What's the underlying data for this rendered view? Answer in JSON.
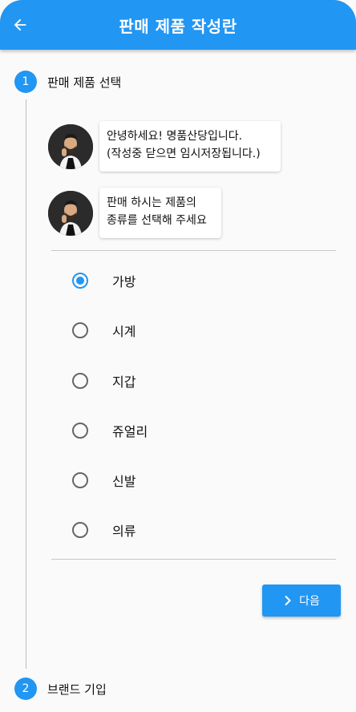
{
  "header": {
    "title": "판매 제품 작성란",
    "back_icon": "arrow-left-icon"
  },
  "steps": [
    {
      "number": "1",
      "label": "판매 제품 선택"
    },
    {
      "number": "2",
      "label": "브랜드 기입"
    }
  ],
  "chat": [
    {
      "line1": "안녕하세요! 명품산당입니다.",
      "line2": "(작성중 닫으면 임시저장됩니다.)"
    },
    {
      "line1": "판매 하시는 제품의",
      "line2": "종류를 선택해 주세요"
    }
  ],
  "options": [
    {
      "label": "가방",
      "selected": true
    },
    {
      "label": "시계",
      "selected": false
    },
    {
      "label": "지갑",
      "selected": false
    },
    {
      "label": "쥬얼리",
      "selected": false
    },
    {
      "label": "신발",
      "selected": false
    },
    {
      "label": "의류",
      "selected": false
    }
  ],
  "next_button": {
    "label": "다음"
  },
  "colors": {
    "primary": "#2196f3",
    "background": "#fafafa"
  }
}
